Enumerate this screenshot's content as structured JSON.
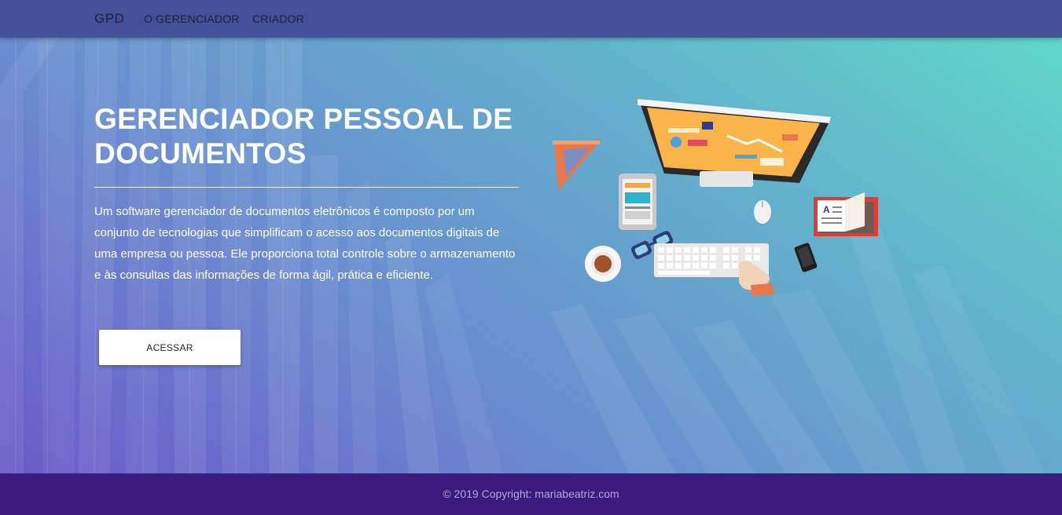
{
  "navbar": {
    "brand": "GPD",
    "links": [
      "O GERENCIADOR",
      "CRIADOR"
    ]
  },
  "hero": {
    "title": "GERENCIADOR PESSOAL DE DOCUMENTOS",
    "description": "Um software gerenciador de documentos eletrônicos é composto por um conjunto de tecnologias que simplificam o acesso aos documentos digitais de uma empresa ou pessoa. Ele proporciona total controle sobre o armazenamento e às consultas das informações de forma ágil, prática e eficiente.",
    "button_label": "ACESSAR"
  },
  "illustration": {
    "icons": [
      "ruler-triangle-icon",
      "monitor-icon",
      "tablet-icon",
      "mouse-icon",
      "book-icon",
      "glasses-icon",
      "coffee-cup-icon",
      "keyboard-icon",
      "hand-icon",
      "smartphone-icon"
    ]
  },
  "footer": {
    "copyright": "© 2019 Copyright: mariabeatriz.com"
  },
  "colors": {
    "navbar": "#434f97",
    "footer": "#3a1c7e",
    "hero_gradient_start": "#6a5ac8",
    "hero_gradient_end": "#5fd7c8"
  }
}
